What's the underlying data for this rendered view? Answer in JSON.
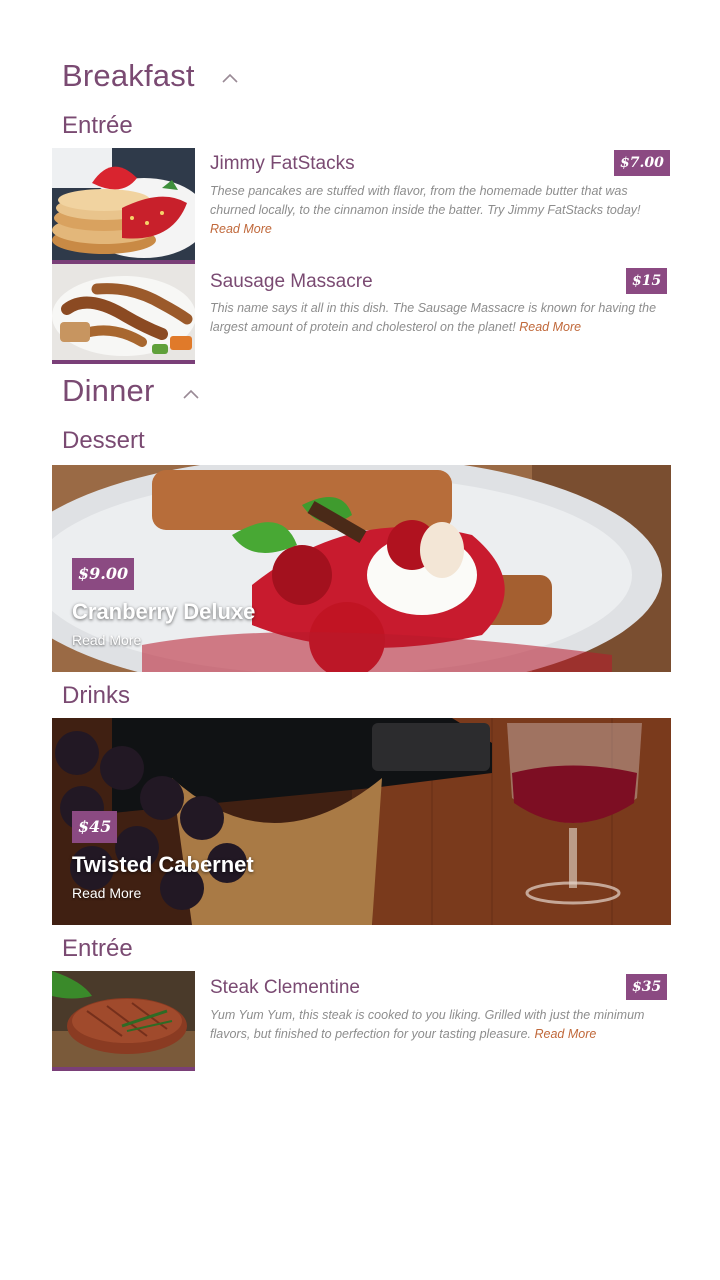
{
  "sections": {
    "breakfast": {
      "title": "Breakfast",
      "entree_label": "Entrée",
      "items": [
        {
          "name": "Jimmy FatStacks",
          "price": "$7.00",
          "description": "These pancakes are stuffed with flavor, from the homemade butter that was churned locally, to the cinnamon inside the batter. Try Jimmy FatStacks today!",
          "read_more": "Read More"
        },
        {
          "name": "Sausage Massacre",
          "price": "$15",
          "description": "This name says it all in this dish. The Sausage Massacre is known for having the largest amount of protein and cholesterol on the planet!",
          "read_more": "Read More"
        }
      ]
    },
    "dinner": {
      "title": "Dinner",
      "dessert_label": "Dessert",
      "dessert": {
        "name": "Cranberry Deluxe",
        "price": "$9.00",
        "read_more": "Read More"
      },
      "drinks_label": "Drinks",
      "drink": {
        "name": "Twisted Cabernet",
        "price": "$45",
        "read_more": "Read More"
      },
      "entree_label": "Entrée",
      "entree": {
        "name": "Steak Clementine",
        "price": "$35",
        "description": "Yum Yum Yum, this steak is cooked to you liking. Grilled with just the minimum flavors, but finished to perfection for your tasting pleasure.",
        "read_more": "Read More"
      }
    }
  },
  "icons": {
    "collapse": "chevron-up-icon"
  },
  "colors": {
    "accent": "#8b4a82",
    "heading": "#7a4a72",
    "link": "#c0683a",
    "body_text": "#8d8d8d"
  }
}
